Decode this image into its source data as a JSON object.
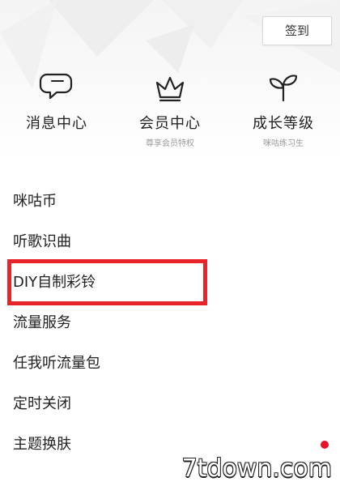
{
  "header": {
    "signin_label": "签到"
  },
  "quick_actions": [
    {
      "label": "消息中心",
      "sub": "",
      "icon": "chat-bubbles-icon"
    },
    {
      "label": "会员中心",
      "sub": "尊享会员特权",
      "icon": "crown-icon"
    },
    {
      "label": "成长等级",
      "sub": "咪咕练习生",
      "icon": "sprout-icon"
    }
  ],
  "menu": {
    "items": [
      {
        "label": "咪咕币"
      },
      {
        "label": "听歌识曲"
      },
      {
        "label": "DIY自制彩铃"
      },
      {
        "label": "流量服务"
      },
      {
        "label": "任我听流量包"
      },
      {
        "label": "定时关闭"
      },
      {
        "label": "主题换肤"
      }
    ]
  },
  "watermark": "7tdown.com",
  "colors": {
    "highlight": "#e8232a",
    "badge": "#e8102a"
  }
}
